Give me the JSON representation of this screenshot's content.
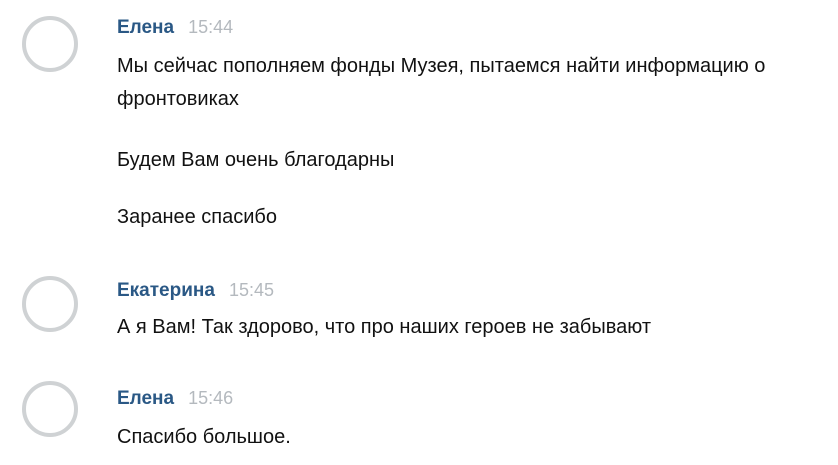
{
  "messages": [
    {
      "author": "Елена",
      "time": "15:44",
      "lines": [
        "Мы сейчас пополняем фонды Музея, пытаемся найти информацию о фронтовиках",
        "Будем Вам очень благодарны",
        "Заранее спасибо"
      ]
    },
    {
      "author": "Екатерина",
      "time": "15:45",
      "lines": [
        "А я Вам! Так здорово, что про наших героев не забывают"
      ]
    },
    {
      "author": "Елена",
      "time": "15:46",
      "lines": [
        "Спасибо большое."
      ]
    }
  ],
  "colors": {
    "author": "#2a5885",
    "time": "#b4b9be",
    "text": "#111111",
    "avatar_ring": "#cfd2d4"
  }
}
